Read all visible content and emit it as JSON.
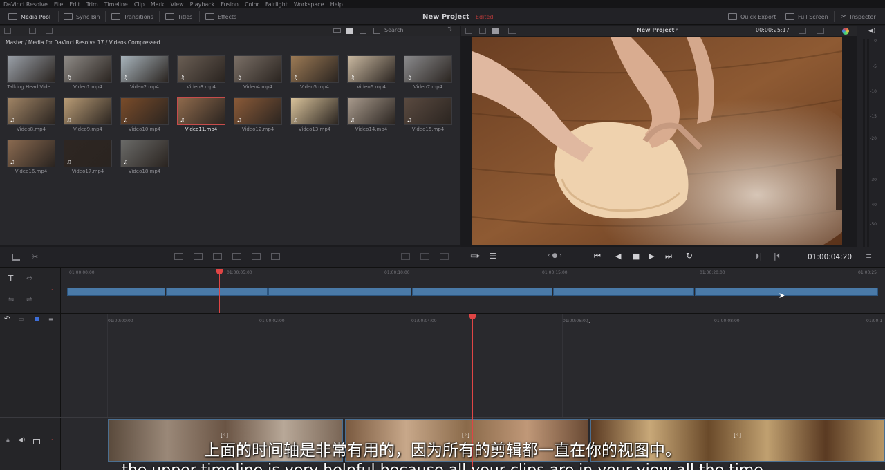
{
  "menu": [
    "DaVinci Resolve",
    "File",
    "Edit",
    "Trim",
    "Timeline",
    "Clip",
    "Mark",
    "View",
    "Playback",
    "Fusion",
    "Color",
    "Fairlight",
    "Workspace",
    "Help"
  ],
  "toolbar": {
    "media_pool": "Media Pool",
    "sync_bin": "Sync Bin",
    "transitions": "Transitions",
    "titles": "Titles",
    "effects": "Effects",
    "project_title": "New Project",
    "project_status": "Edited",
    "quick_export": "Quick Export",
    "full_screen": "Full Screen",
    "inspector": "Inspector"
  },
  "pool": {
    "search_label": "Search",
    "breadcrumb": "Master / Media for DaVinci Resolve 17 / Videos Compressed",
    "clips": [
      {
        "label": "Talking Head Vide...",
        "color": "#9aa0a8"
      },
      {
        "label": "Video1.mp4",
        "color": "#8e8a86"
      },
      {
        "label": "Video2.mp4",
        "color": "#a8b4bc"
      },
      {
        "label": "Video3.mp4",
        "color": "#6a5e54"
      },
      {
        "label": "Video4.mp4",
        "color": "#7a6f66"
      },
      {
        "label": "Video5.mp4",
        "color": "#9c7a55"
      },
      {
        "label": "Video6.mp4",
        "color": "#c9b8a0"
      },
      {
        "label": "Video7.mp4",
        "color": "#8a8a8c"
      },
      {
        "label": "Video8.mp4",
        "color": "#a08465"
      },
      {
        "label": "Video9.mp4",
        "color": "#b89b75"
      },
      {
        "label": "Video10.mp4",
        "color": "#7a4c2a"
      },
      {
        "label": "Video11.mp4",
        "color": "#8f6a4c"
      },
      {
        "label": "Video12.mp4",
        "color": "#8a5a38"
      },
      {
        "label": "Video13.mp4",
        "color": "#d8c29a"
      },
      {
        "label": "Video14.mp4",
        "color": "#a89a8c"
      },
      {
        "label": "Video15.mp4",
        "color": "#5a4a40"
      },
      {
        "label": "Video16.mp4",
        "color": "#8a6a50"
      },
      {
        "label": "Video17.mp4",
        "color": "#2e2622"
      },
      {
        "label": "Video18.mp4",
        "color": "#6a6a68"
      }
    ],
    "selected_clip": "Video11.mp4"
  },
  "viewer": {
    "project_name": "New Project",
    "duration": "00:00:25:17",
    "timecode": "01:00:04:20",
    "meter_ticks": [
      "0",
      "-5",
      "-10",
      "-15",
      "-20",
      "-30",
      "-40",
      "-50"
    ]
  },
  "upper_timeline": {
    "ruler": [
      "01:00:00:00",
      "01:00:05:00",
      "01:00:10:00",
      "01:00:15:00",
      "01:00:20:00",
      "01:00:25"
    ],
    "track_number": "1"
  },
  "lower_timeline": {
    "ruler": [
      "01:00:00:00",
      "01:00:02:00",
      "01:00:04:00",
      "01:00:06:00",
      "01:00:08:00",
      "01:00:1"
    ],
    "track_number": "1"
  },
  "subtitles": {
    "zh": "上面的时间轴是非常有用的，因为所有的剪辑都一直在你的视图中。",
    "en": "the upper timeline is very helpful because all your clips are in your view all the time"
  }
}
